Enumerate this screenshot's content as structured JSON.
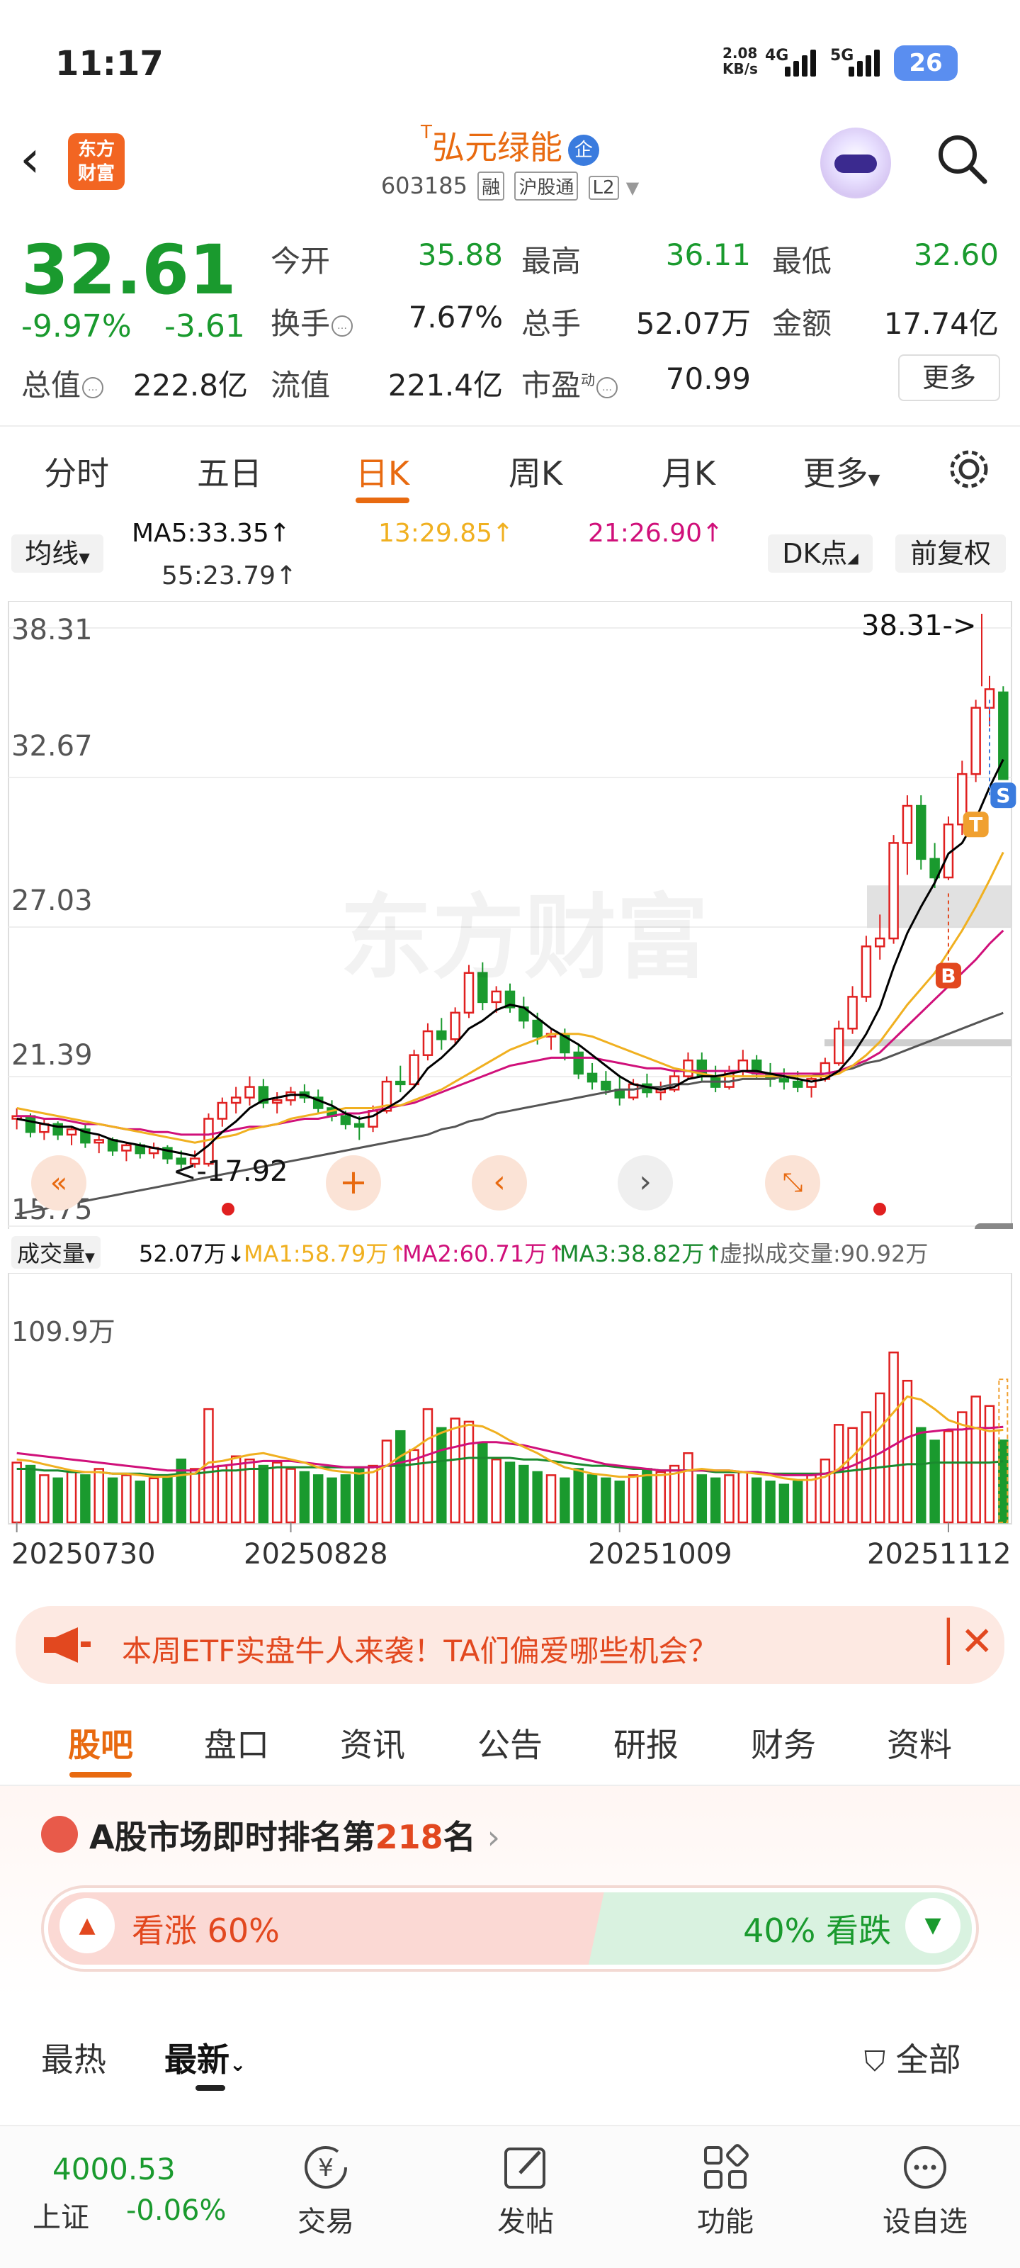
{
  "status_bar": {
    "time": "11:17",
    "net_speed": "2.08",
    "net_unit": "KB/s",
    "sig1": "4G",
    "sig2": "5G",
    "battery": "26"
  },
  "header": {
    "logo_line1": "东方",
    "logo_line2": "财富",
    "stock_name": "弘元绿能",
    "name_prefix": "T",
    "qi_badge": "企",
    "code": "603185",
    "tag_rong": "融",
    "tag_hgt": "沪股通",
    "tag_l2": "L2"
  },
  "quote": {
    "price": "32.61",
    "change_pct": "-9.97%",
    "change_amt": "-3.61",
    "open_label": "今开",
    "open": "35.88",
    "high_label": "最高",
    "high": "36.11",
    "low_label": "最低",
    "low": "32.60",
    "turnover_label": "换手",
    "turnover": "7.67%",
    "volume_label": "总手",
    "volume": "52.07万",
    "amount_label": "金额",
    "amount": "17.74亿",
    "mktcap_label": "总值",
    "mktcap": "222.8亿",
    "float_label": "流值",
    "float": "221.4亿",
    "pe_label": "市盈",
    "pe_sup": "动",
    "pe": "70.99",
    "more": "更多"
  },
  "tabs": [
    "分时",
    "五日",
    "日K",
    "周K",
    "月K",
    "更多"
  ],
  "ma_bar": {
    "selector": "均线",
    "ma5": "MA5:33.35",
    "ma13": "13:29.85",
    "ma21": "21:26.90",
    "ma55": "55:23.79",
    "dk": "DK点",
    "fq": "前复权"
  },
  "chart_data": {
    "type": "candlestick",
    "price_axis_labels": [
      "38.31",
      "32.67",
      "27.03",
      "21.39",
      "15.75"
    ],
    "max_marker": "38.31->",
    "min_marker": "<-17.92",
    "watermark": "东方财富",
    "x_labels": [
      "20250730",
      "20250828",
      "20251009",
      "20251112"
    ],
    "volume_axis_label": "109.9万",
    "signal_markers": [
      "S",
      "T",
      "B"
    ],
    "ohlc": [
      [
        19.8,
        20.2,
        19.4,
        19.9
      ],
      [
        19.9,
        20.0,
        19.1,
        19.3
      ],
      [
        19.3,
        19.8,
        19.0,
        19.6
      ],
      [
        19.6,
        19.7,
        19.0,
        19.2
      ],
      [
        19.2,
        19.5,
        18.8,
        19.4
      ],
      [
        19.4,
        19.6,
        18.7,
        18.9
      ],
      [
        18.9,
        19.2,
        18.5,
        19.0
      ],
      [
        19.0,
        19.1,
        18.4,
        18.6
      ],
      [
        18.6,
        18.9,
        18.2,
        18.8
      ],
      [
        18.8,
        18.9,
        18.3,
        18.5
      ],
      [
        18.5,
        18.9,
        18.3,
        18.7
      ],
      [
        18.7,
        18.8,
        18.1,
        18.3
      ],
      [
        18.3,
        18.6,
        17.92,
        18.1
      ],
      [
        18.1,
        18.6,
        17.95,
        18.3
      ],
      [
        18.1,
        20.0,
        18.0,
        19.8
      ],
      [
        19.8,
        20.6,
        19.5,
        20.4
      ],
      [
        20.4,
        21.0,
        20.0,
        20.6
      ],
      [
        20.6,
        21.4,
        20.3,
        21.0
      ],
      [
        21.0,
        21.3,
        20.2,
        20.4
      ],
      [
        20.4,
        20.8,
        20.0,
        20.5
      ],
      [
        20.5,
        21.0,
        20.3,
        20.8
      ],
      [
        20.8,
        21.1,
        20.4,
        20.6
      ],
      [
        20.6,
        20.9,
        20.0,
        20.2
      ],
      [
        20.2,
        20.5,
        19.7,
        19.9
      ],
      [
        19.9,
        20.1,
        19.4,
        19.6
      ],
      [
        19.6,
        19.9,
        19.0,
        19.5
      ],
      [
        19.5,
        20.3,
        19.3,
        20.1
      ],
      [
        20.1,
        21.4,
        20.0,
        21.2
      ],
      [
        21.2,
        21.8,
        20.8,
        21.1
      ],
      [
        21.1,
        22.4,
        21.0,
        22.2
      ],
      [
        22.2,
        23.4,
        22.0,
        23.1
      ],
      [
        23.1,
        23.6,
        22.4,
        22.8
      ],
      [
        22.8,
        24.0,
        22.6,
        23.8
      ],
      [
        23.8,
        25.6,
        23.6,
        25.3
      ],
      [
        25.3,
        25.7,
        23.9,
        24.2
      ],
      [
        24.2,
        24.8,
        23.8,
        24.6
      ],
      [
        24.6,
        24.9,
        23.8,
        24.0
      ],
      [
        24.0,
        24.4,
        23.2,
        23.5
      ],
      [
        23.5,
        23.8,
        22.6,
        22.9
      ],
      [
        22.9,
        23.2,
        22.4,
        23.0
      ],
      [
        23.0,
        23.2,
        22.0,
        22.3
      ],
      [
        22.3,
        22.6,
        21.3,
        21.5
      ],
      [
        21.5,
        21.9,
        20.9,
        21.2
      ],
      [
        21.2,
        21.6,
        20.7,
        20.9
      ],
      [
        20.9,
        21.4,
        20.3,
        20.6
      ],
      [
        20.6,
        21.3,
        20.5,
        21.1
      ],
      [
        21.1,
        21.5,
        20.6,
        20.8
      ],
      [
        20.8,
        21.2,
        20.5,
        20.9
      ],
      [
        20.9,
        21.6,
        20.8,
        21.4
      ],
      [
        21.4,
        22.3,
        21.3,
        22.0
      ],
      [
        22.0,
        22.3,
        21.2,
        21.4
      ],
      [
        21.4,
        21.8,
        20.8,
        21.0
      ],
      [
        21.0,
        21.8,
        20.9,
        21.6
      ],
      [
        21.6,
        22.4,
        21.4,
        22.0
      ],
      [
        22.0,
        22.2,
        21.3,
        21.5
      ],
      [
        21.5,
        21.9,
        21.0,
        21.3
      ],
      [
        21.3,
        21.7,
        20.9,
        21.2
      ],
      [
        21.2,
        21.6,
        20.8,
        21.0
      ],
      [
        21.0,
        21.4,
        20.6,
        21.3
      ],
      [
        21.3,
        22.1,
        21.2,
        21.9
      ],
      [
        21.9,
        23.5,
        21.8,
        23.2
      ],
      [
        23.2,
        24.8,
        23.0,
        24.4
      ],
      [
        24.4,
        26.7,
        24.2,
        26.3
      ],
      [
        26.3,
        27.5,
        25.8,
        26.6
      ],
      [
        26.6,
        30.5,
        26.4,
        30.2
      ],
      [
        30.2,
        32.0,
        29.0,
        31.6
      ],
      [
        31.6,
        32.0,
        29.2,
        29.6
      ],
      [
        29.6,
        30.2,
        28.5,
        28.9
      ],
      [
        28.9,
        31.2,
        28.8,
        30.9
      ],
      [
        30.9,
        33.3,
        30.5,
        32.8
      ],
      [
        32.8,
        35.6,
        32.5,
        35.3
      ],
      [
        35.3,
        36.5,
        34.6,
        36.0
      ],
      [
        35.88,
        36.11,
        32.6,
        32.61
      ]
    ],
    "ma5": [
      19.8,
      19.7,
      19.6,
      19.5,
      19.5,
      19.3,
      19.2,
      19.0,
      18.9,
      18.8,
      18.7,
      18.6,
      18.5,
      18.4,
      18.8,
      19.3,
      19.7,
      20.2,
      20.5,
      20.6,
      20.7,
      20.7,
      20.5,
      20.3,
      20.0,
      19.8,
      19.9,
      20.2,
      20.5,
      21.0,
      21.7,
      22.1,
      22.6,
      23.2,
      23.5,
      23.9,
      24.1,
      24.0,
      23.6,
      23.2,
      22.9,
      22.6,
      22.2,
      21.8,
      21.4,
      21.1,
      21.0,
      20.9,
      21.0,
      21.3,
      21.4,
      21.4,
      21.5,
      21.6,
      21.6,
      21.5,
      21.4,
      21.3,
      21.2,
      21.3,
      21.6,
      22.2,
      23.0,
      24.0,
      25.5,
      26.8,
      27.8,
      28.7,
      29.8,
      30.2,
      31.1,
      32.3,
      33.35
    ],
    "ma13": [
      20.2,
      20.1,
      20.0,
      19.9,
      19.8,
      19.7,
      19.6,
      19.5,
      19.4,
      19.3,
      19.2,
      19.1,
      19.0,
      18.9,
      19.0,
      19.1,
      19.2,
      19.4,
      19.5,
      19.6,
      19.8,
      19.9,
      20.0,
      20.1,
      20.2,
      20.2,
      20.2,
      20.3,
      20.3,
      20.5,
      20.7,
      20.9,
      21.2,
      21.5,
      21.8,
      22.1,
      22.4,
      22.6,
      22.8,
      23.0,
      23.0,
      23.0,
      22.9,
      22.7,
      22.5,
      22.3,
      22.1,
      21.9,
      21.7,
      21.6,
      21.5,
      21.4,
      21.4,
      21.4,
      21.4,
      21.4,
      21.4,
      21.4,
      21.4,
      21.4,
      21.5,
      21.8,
      22.2,
      22.7,
      23.4,
      24.1,
      24.7,
      25.3,
      26.1,
      26.9,
      27.8,
      28.8,
      29.85
    ],
    "ma21": [
      19.9,
      19.9,
      19.8,
      19.8,
      19.7,
      19.6,
      19.6,
      19.5,
      19.4,
      19.4,
      19.3,
      19.3,
      19.2,
      19.2,
      19.2,
      19.3,
      19.4,
      19.5,
      19.5,
      19.6,
      19.7,
      19.8,
      19.8,
      19.9,
      20.0,
      20.0,
      20.1,
      20.2,
      20.3,
      20.4,
      20.6,
      20.8,
      21.0,
      21.2,
      21.4,
      21.6,
      21.8,
      21.9,
      22.0,
      22.1,
      22.1,
      22.1,
      22.1,
      22.0,
      21.9,
      21.8,
      21.7,
      21.7,
      21.6,
      21.6,
      21.6,
      21.6,
      21.6,
      21.6,
      21.5,
      21.5,
      21.5,
      21.5,
      21.5,
      21.5,
      21.6,
      21.8,
      22.0,
      22.3,
      22.8,
      23.3,
      23.8,
      24.3,
      24.8,
      25.3,
      25.8,
      26.4,
      26.9
    ],
    "ma55": [
      16.2,
      16.3,
      16.4,
      16.5,
      16.6,
      16.7,
      16.8,
      16.9,
      17.0,
      17.1,
      17.2,
      17.3,
      17.4,
      17.5,
      17.6,
      17.7,
      17.8,
      17.9,
      18.0,
      18.1,
      18.2,
      18.3,
      18.4,
      18.5,
      18.6,
      18.7,
      18.8,
      18.9,
      19.0,
      19.1,
      19.2,
      19.4,
      19.5,
      19.7,
      19.8,
      20.0,
      20.1,
      20.2,
      20.3,
      20.4,
      20.5,
      20.6,
      20.7,
      20.8,
      20.9,
      20.9,
      21.0,
      21.0,
      21.1,
      21.1,
      21.2,
      21.2,
      21.2,
      21.3,
      21.3,
      21.3,
      21.4,
      21.4,
      21.4,
      21.5,
      21.6,
      21.7,
      21.9,
      22.0,
      22.2,
      22.4,
      22.6,
      22.8,
      23.0,
      23.2,
      23.4,
      23.6,
      23.79
    ],
    "volume": [
      38,
      36,
      30,
      28,
      32,
      30,
      34,
      28,
      30,
      26,
      28,
      30,
      40,
      34,
      72,
      36,
      42,
      40,
      36,
      38,
      34,
      32,
      30,
      28,
      30,
      34,
      36,
      52,
      58,
      46,
      72,
      60,
      66,
      64,
      50,
      40,
      38,
      36,
      32,
      30,
      28,
      34,
      30,
      28,
      26,
      30,
      34,
      32,
      36,
      44,
      30,
      28,
      30,
      32,
      28,
      26,
      24,
      26,
      30,
      40,
      62,
      60,
      70,
      82,
      108,
      90,
      60,
      52,
      58,
      70,
      80,
      74,
      52.07
    ],
    "vol_ma1": [
      40,
      39,
      37,
      35,
      33,
      32,
      32,
      31,
      31,
      30,
      29,
      29,
      30,
      31,
      38,
      39,
      41,
      43,
      44,
      42,
      40,
      38,
      35,
      33,
      32,
      31,
      32,
      36,
      42,
      47,
      53,
      57,
      60,
      62,
      61,
      57,
      52,
      48,
      44,
      39,
      35,
      33,
      31,
      30,
      29,
      29,
      30,
      30,
      31,
      33,
      34,
      33,
      33,
      32,
      31,
      30,
      28,
      27,
      27,
      29,
      34,
      42,
      51,
      60,
      70,
      80,
      78,
      72,
      65,
      62,
      60,
      58,
      58.79
    ],
    "vol_ma2": [
      44,
      43,
      42,
      41,
      40,
      39,
      38,
      37,
      36,
      35,
      34,
      33,
      33,
      33,
      35,
      36,
      37,
      38,
      39,
      39,
      39,
      38,
      37,
      36,
      35,
      35,
      35,
      36,
      38,
      40,
      43,
      46,
      48,
      50,
      51,
      51,
      50,
      49,
      47,
      45,
      43,
      41,
      39,
      37,
      36,
      35,
      34,
      33,
      33,
      33,
      33,
      33,
      33,
      32,
      32,
      31,
      30,
      30,
      30,
      31,
      33,
      36,
      40,
      44,
      49,
      54,
      57,
      58,
      59,
      59,
      60,
      60,
      60.71
    ],
    "vol_ma3": [
      34,
      34,
      33,
      33,
      32,
      32,
      32,
      31,
      31,
      31,
      30,
      30,
      31,
      31,
      32,
      33,
      33,
      34,
      34,
      35,
      35,
      35,
      35,
      35,
      35,
      35,
      35,
      36,
      36,
      37,
      38,
      39,
      40,
      41,
      41,
      41,
      41,
      40,
      40,
      39,
      38,
      37,
      36,
      36,
      35,
      34,
      34,
      33,
      33,
      33,
      33,
      32,
      32,
      32,
      32,
      31,
      31,
      31,
      31,
      31,
      32,
      33,
      34,
      35,
      36,
      37,
      37,
      38,
      38,
      38,
      38,
      38,
      38.82
    ]
  },
  "vol_legend": {
    "selector": "成交量",
    "vol": "52.07万",
    "ma1": "MA1:58.79万",
    "ma2": "MA2:60.71万",
    "ma3": "MA3:38.82万",
    "virtual": "虚拟成交量:90.92万"
  },
  "banner": {
    "text": "本周ETF实盘牛人来袭！TA们偏爱哪些机会？"
  },
  "sub_tabs": [
    "股吧",
    "盘口",
    "资讯",
    "公告",
    "研报",
    "财务",
    "资料"
  ],
  "ranking": {
    "prefix": "A股市场即时排名第",
    "rank": "218",
    "suffix": "名"
  },
  "vote": {
    "up": "看涨 60%",
    "down": "40% 看跌",
    "up_pct": 60
  },
  "feed": {
    "hot": "最热",
    "latest": "最新",
    "all": "全部"
  },
  "bottom_bar": {
    "index_value": "4000.53",
    "index_name": "上证",
    "index_change": "-0.06%",
    "nav": [
      "交易",
      "发帖",
      "功能",
      "设自选"
    ]
  },
  "colors": {
    "up": "#e02020",
    "down": "#1a9a2e",
    "accent": "#e86a10",
    "ma5": "#000000",
    "ma13": "#f0b020",
    "ma21": "#d0107a",
    "ma55": "#555555"
  }
}
